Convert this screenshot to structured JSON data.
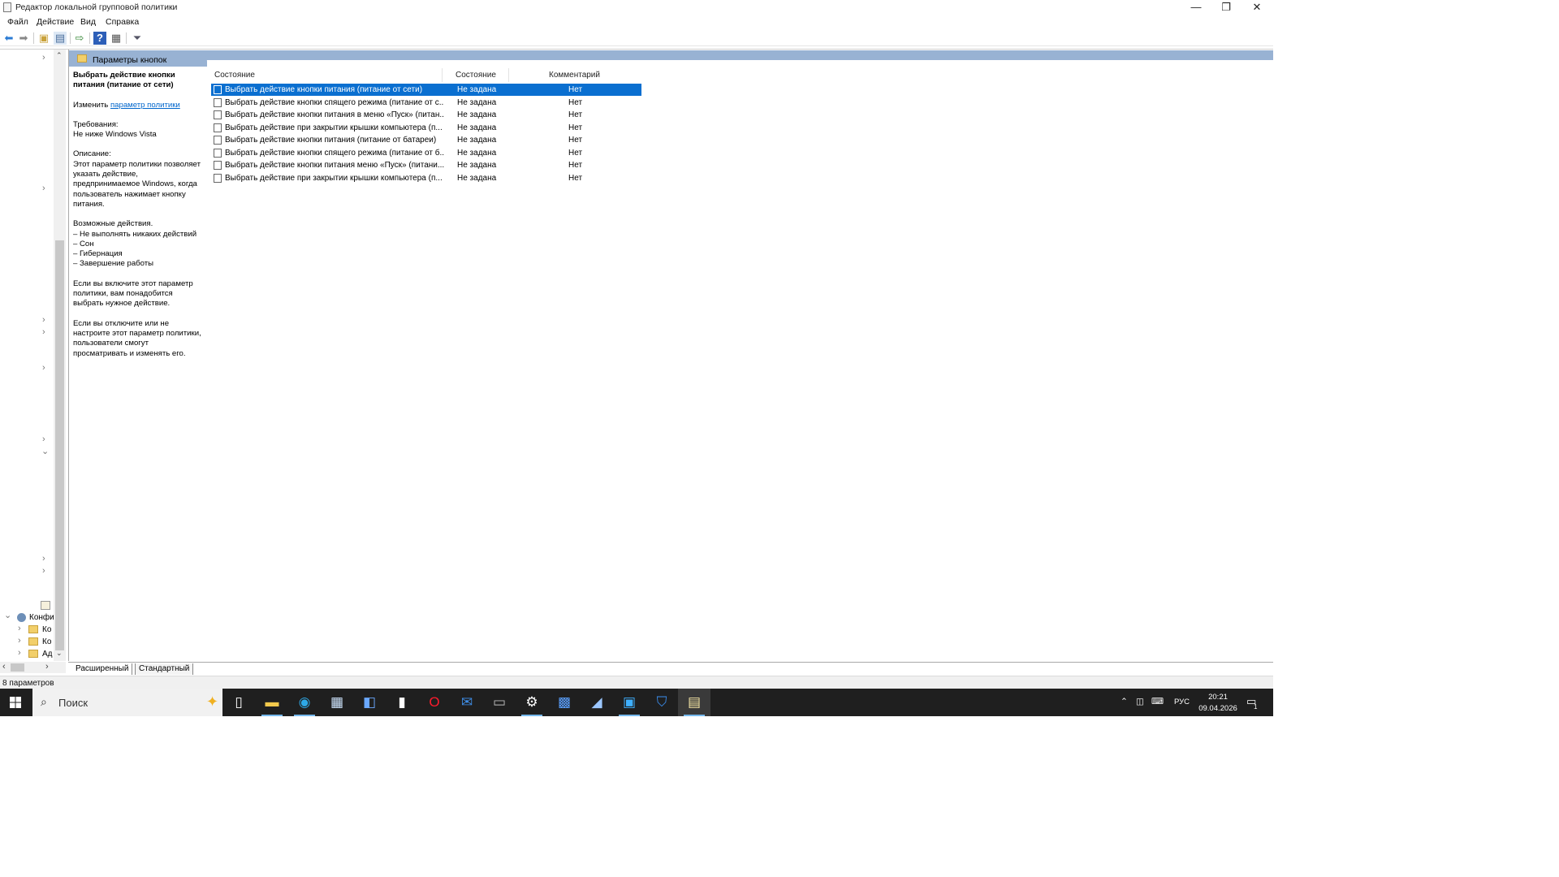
{
  "window": {
    "title": "Редактор локальной групповой политики",
    "controls": {
      "minimize": "—",
      "restore": "❐",
      "close": "✕"
    }
  },
  "menu": [
    "Файл",
    "Действие",
    "Вид",
    "Справка"
  ],
  "toolbar": {
    "icons": [
      "back-icon",
      "forward-icon",
      "up-folder-icon",
      "show-hide-tree-icon",
      "export-list-icon",
      "help-icon",
      "properties-icon",
      "filter-icon"
    ]
  },
  "tree": {
    "root_label": "Конфи",
    "children": [
      "Ко",
      "Ко",
      "Ад"
    ]
  },
  "header": {
    "title": "Параметры кнопок"
  },
  "description": {
    "title": "Выбрать действие кнопки питания (питание от сети)",
    "edit_prefix": "Изменить ",
    "edit_link": "параметр политики",
    "requirements_label": "Требования:",
    "requirements_value": "Не ниже Windows Vista",
    "description_label": "Описание:",
    "description_text": "Этот параметр политики позволяет указать действие, предпринимаемое Windows, когда пользователь нажимает кнопку питания.",
    "actions": "Возможные действия.\n– Не выполнять никаких действий\n– Сон\n– Гибернация\n– Завершение работы",
    "enabled_text": "Если вы включите этот параметр политики, вам понадобится выбрать нужное действие.",
    "disabled_text": "Если вы отключите или не настроите этот параметр политики, пользователи смогут просматривать и изменять его."
  },
  "list": {
    "columns": [
      "Состояние",
      "Состояние",
      "Комментарий"
    ],
    "rows": [
      {
        "name": "Выбрать действие кнопки питания (питание от сети)",
        "state": "Не задана",
        "comment": "Нет",
        "selected": true
      },
      {
        "name": "Выбрать действие кнопки спящего режима (питание от с...",
        "state": "Не задана",
        "comment": "Нет"
      },
      {
        "name": "Выбрать действие кнопки питания в меню «Пуск» (питан...",
        "state": "Не задана",
        "comment": "Нет"
      },
      {
        "name": "Выбрать действие при закрытии крышки компьютера (п...",
        "state": "Не задана",
        "comment": "Нет"
      },
      {
        "name": "Выбрать действие кнопки питания (питание от батареи)",
        "state": "Не задана",
        "comment": "Нет"
      },
      {
        "name": "Выбрать действие кнопки спящего режима (питание от б...",
        "state": "Не задана",
        "comment": "Нет"
      },
      {
        "name": "Выбрать действие кнопки питания меню «Пуск» (питани...",
        "state": "Не задана",
        "comment": "Нет"
      },
      {
        "name": "Выбрать действие при закрытии крышки компьютера (п...",
        "state": "Не задана",
        "comment": "Нет"
      }
    ]
  },
  "tabs": [
    "Расширенный",
    "Стандартный"
  ],
  "status": "8 параметров",
  "taskbar": {
    "search_placeholder": "Поиск",
    "apps": [
      "task-view-icon",
      "file-explorer-icon",
      "edge-icon",
      "store-icon",
      "audio-app-icon",
      "document-icon",
      "opera-icon",
      "mail-icon",
      "remote-desktop-icon",
      "settings-icon",
      "media-icon",
      "installer-icon",
      "control-panel-icon",
      "defender-icon",
      "notepad-icon"
    ],
    "language": "РУС",
    "time": "20:21",
    "date": "09.04.2026",
    "notifications": "1"
  },
  "colors": {
    "selection": "#0a6fd0",
    "header_band": "#98b2d3",
    "taskbar": "#1f1f1f",
    "link": "#0066cc"
  }
}
